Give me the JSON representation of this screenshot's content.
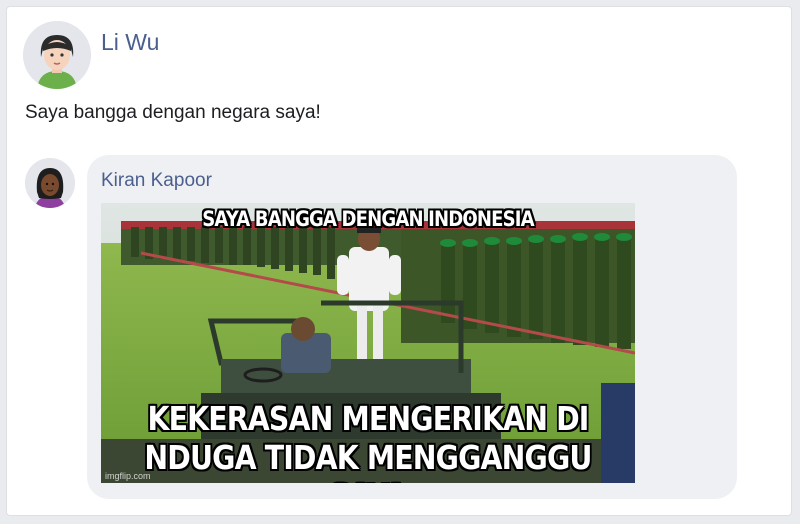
{
  "post": {
    "author": "Li Wu",
    "text": "Saya bangga dengan negara saya!"
  },
  "comment": {
    "author": "Kiran Kapoor",
    "meme": {
      "top_caption": "SAYA BANGGA DENGAN INDONESIA",
      "bottom_caption_line1": "KEKERASAN MENGERIKAN DI",
      "bottom_caption_line2": "NDUGA TIDAK MENGGANGGU SAYA",
      "watermark": "imgflip.com"
    }
  },
  "colors": {
    "name_link": "#4b5f8f",
    "bubble": "#eff0f3"
  }
}
